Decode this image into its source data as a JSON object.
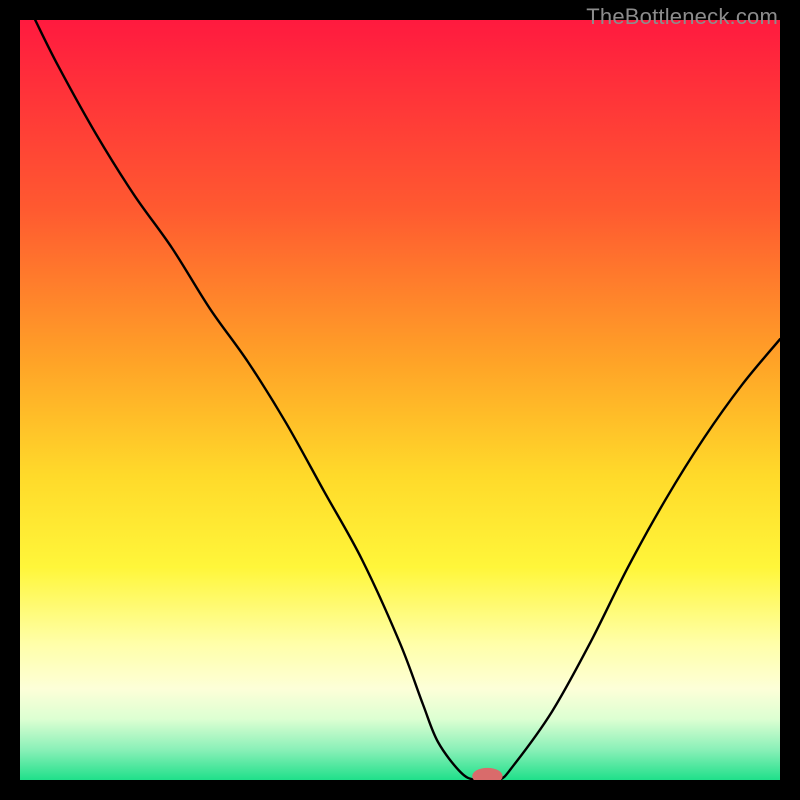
{
  "watermark": {
    "text": "TheBottleneck.com"
  },
  "chart_data": {
    "type": "line",
    "title": "",
    "xlabel": "",
    "ylabel": "",
    "xlim": [
      0,
      100
    ],
    "ylim": [
      0,
      100
    ],
    "series": [
      {
        "name": "bottleneck-curve",
        "x": [
          2,
          5,
          10,
          15,
          20,
          25,
          30,
          35,
          40,
          45,
          50,
          53,
          55,
          58,
          60,
          63,
          65,
          70,
          75,
          80,
          85,
          90,
          95,
          100
        ],
        "y": [
          100,
          94,
          85,
          77,
          70,
          62,
          55,
          47,
          38,
          29,
          18,
          10,
          5,
          1,
          0,
          0,
          2,
          9,
          18,
          28,
          37,
          45,
          52,
          58
        ]
      }
    ],
    "gradient_stops": [
      {
        "offset": 0,
        "color": "#ff1a3f"
      },
      {
        "offset": 25,
        "color": "#ff5a30"
      },
      {
        "offset": 45,
        "color": "#ffa327"
      },
      {
        "offset": 60,
        "color": "#ffda2a"
      },
      {
        "offset": 72,
        "color": "#fff63a"
      },
      {
        "offset": 82,
        "color": "#ffffa8"
      },
      {
        "offset": 88,
        "color": "#fdffd8"
      },
      {
        "offset": 92,
        "color": "#dcffd2"
      },
      {
        "offset": 96,
        "color": "#8af0b8"
      },
      {
        "offset": 100,
        "color": "#1fe08a"
      }
    ],
    "marker": {
      "x": 61.5,
      "y": 0.5,
      "color": "#d96b6b",
      "rx": 2.0,
      "ry": 1.1
    }
  }
}
